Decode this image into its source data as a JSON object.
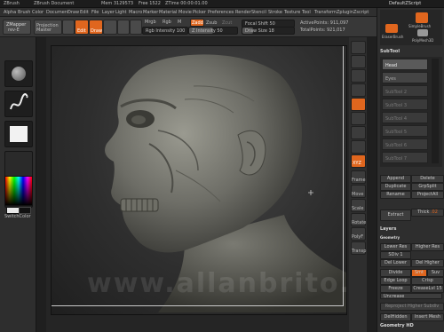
{
  "titlebar": {
    "app": "ZBrush",
    "doc": "ZBrush Document",
    "mem": "Mem 3129573",
    "free": "Free 1522",
    "timer": "ZTime 00:00:01.00",
    "script": "DefaultZScript"
  },
  "menus": [
    "Alpha",
    "Brush",
    "Color",
    "Document",
    "Draw",
    "Edit",
    "File",
    "Layer",
    "Light",
    "Macro",
    "Marker",
    "Material",
    "Movie",
    "Picker",
    "Preferences",
    "Render",
    "Stencil",
    "Stroke",
    "Texture",
    "Tool",
    "Transform",
    "Zplugin",
    "Zscript"
  ],
  "toolbar": {
    "projection_master": "Projection Master",
    "lightbox": "LightBox",
    "edit": "Edit",
    "draw": "Draw",
    "move": "Move",
    "scale": "Scale",
    "rotate": "Rotate",
    "mrgb": "Mrgb",
    "rgb": "Rgb",
    "m": "M",
    "rgb_intensity": "Rgb Intensity 100",
    "zadd": "Zadd",
    "zsub": "Zsub",
    "zcut": "Zcut",
    "z_intensity": "Z Intensity 50",
    "focal_shift": "Focal Shift 50",
    "draw_size": "Draw Size 18",
    "active_points": "ActivePoints: 911,097",
    "total_points": "TotalPoints: 921,017"
  },
  "leftshelf": {
    "zmapper": "ZMapper",
    "zmapper_sub": "rev-E",
    "switch_color": "SwitchColor",
    "colors": {
      "primary": "#e8e8e8",
      "secondary": "#111111"
    }
  },
  "rightshelf": {
    "icons": [
      "bpr-icon",
      "spix-icon",
      "scroll-icon",
      "zoom-icon",
      "actual-icon",
      "aahalf-icon",
      "persp-icon",
      "floor-icon",
      "local-icon",
      "xyz-icon",
      "frame-icon",
      "move-icon",
      "scale-icon",
      "rotate-icon",
      "polyf-icon",
      "transp-icon",
      "ghost-icon",
      "solo-icon"
    ],
    "labels": {
      "xyz": "XYZ",
      "frame": "Frame",
      "move": "Move",
      "scale": "Scale",
      "rotate": "Rotate",
      "polyf": "PolyF",
      "transp": "Transp"
    }
  },
  "panel": {
    "tools": [
      "SimpleBrush",
      "EraserBrush",
      "PolyMesh3D"
    ],
    "subtool_header": "SubTool",
    "subtools": [
      "Head",
      "Eyes",
      "SubTool 2",
      "SubTool 3",
      "SubTool 4",
      "SubTool 5",
      "SubTool 6",
      "SubTool 7"
    ],
    "append": "Append",
    "delete": "Delete",
    "duplicate": "Duplicate",
    "groupsplit": "GrpSplit",
    "rename": "Rename",
    "projectall": "ProjectAll",
    "extract": "Extract",
    "thick": "Thick",
    "thick_value": ".02",
    "layers_header": "Layers",
    "geometry_header": "Geometry",
    "lower_res": "Lower Res",
    "higher_res": "Higher Res",
    "sdiv": "SDiv 1",
    "del_lower": "Del Lower",
    "del_higher": "Del Higher",
    "divide": "Divide",
    "smt": "Smt",
    "suv": "Suv",
    "edge_loop": "Edge Loop",
    "crisp": "Crisp",
    "freeze": "Freeze",
    "crease_lvl": "CreaseLvl 15",
    "uncrease": "Uncrease",
    "reproject": "Reproject Higher Subdiv",
    "delhidden": "DelHidden",
    "insert_mesh": "Insert Mesh",
    "geometry_hd": "Geometry HD"
  },
  "watermark": "www.allanbrito.com"
}
